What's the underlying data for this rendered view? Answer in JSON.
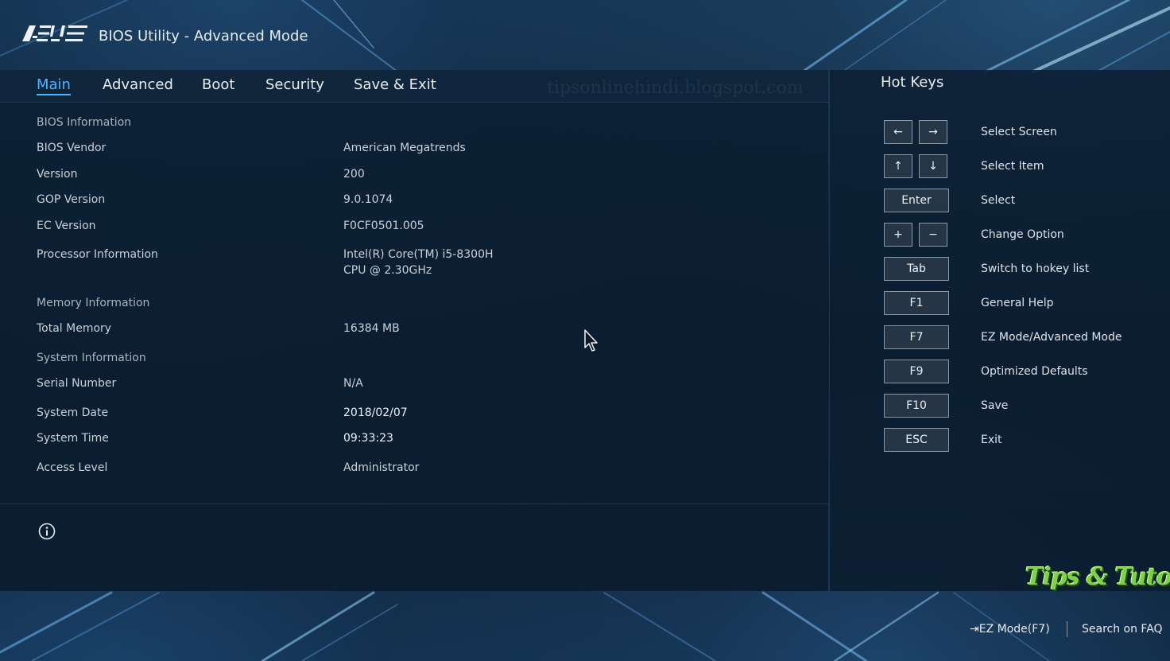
{
  "header": {
    "logo": "ASUS",
    "title": "BIOS Utility - Advanced Mode"
  },
  "tabs": [
    {
      "label": "Main",
      "active": true
    },
    {
      "label": "Advanced",
      "active": false
    },
    {
      "label": "Boot",
      "active": false
    },
    {
      "label": "Security",
      "active": false
    },
    {
      "label": "Save & Exit",
      "active": false
    }
  ],
  "watermark": "tipsonlinehindi.blogspot.com",
  "main": {
    "bios_info_heading": "BIOS Information",
    "bios_vendor_label": "BIOS Vendor",
    "bios_vendor_value": "American Megatrends",
    "version_label": "Version",
    "version_value": "200",
    "gop_version_label": "GOP Version",
    "gop_version_value": "9.0.1074",
    "ec_version_label": "EC Version",
    "ec_version_value": "F0CF0501.005",
    "processor_label": "Processor Information",
    "processor_value_line1": "Intel(R) Core(TM) i5-8300H",
    "processor_value_line2": "CPU @ 2.30GHz",
    "memory_info_heading": "Memory Information",
    "total_memory_label": "Total Memory",
    "total_memory_value": "16384 MB",
    "system_info_heading": "System Information",
    "serial_label": "Serial Number",
    "serial_value": "N/A",
    "system_date_label": "System Date",
    "system_date_value": "2018/02/07",
    "system_time_label": "System Time",
    "system_time_value": "09:33:23",
    "access_level_label": "Access Level",
    "access_level_value": "Administrator"
  },
  "hotkeys": {
    "title": "Hot Keys",
    "items": [
      {
        "keys": [
          "←",
          "→"
        ],
        "label": "Select Screen"
      },
      {
        "keys": [
          "↑",
          "↓"
        ],
        "label": "Select Item"
      },
      {
        "keys": [
          "Enter"
        ],
        "label": "Select"
      },
      {
        "keys": [
          "+",
          "−"
        ],
        "label": "Change Option"
      },
      {
        "keys": [
          "Tab"
        ],
        "label": "Switch to hokey list"
      },
      {
        "keys": [
          "F1"
        ],
        "label": "General Help"
      },
      {
        "keys": [
          "F7"
        ],
        "label": "EZ Mode/Advanced Mode"
      },
      {
        "keys": [
          "F9"
        ],
        "label": "Optimized Defaults"
      },
      {
        "keys": [
          "F10"
        ],
        "label": "Save"
      },
      {
        "keys": [
          "ESC"
        ],
        "label": "Exit"
      }
    ]
  },
  "footer": {
    "ez_mode": "EZ Mode(F7)",
    "faq": "Search on FAQ"
  },
  "tips_logo": "Tips & Tutorial",
  "icons": {
    "logo": "asus-logo",
    "info": "info-icon",
    "cursor": "mouse-cursor-icon",
    "ez_mode": "exit-arrow-icon"
  },
  "colors": {
    "accent": "#4fb2ff",
    "background": "#071423",
    "panel": "#0c2034",
    "text": "#d7dde4",
    "tips_logo": "#7fd14a"
  }
}
